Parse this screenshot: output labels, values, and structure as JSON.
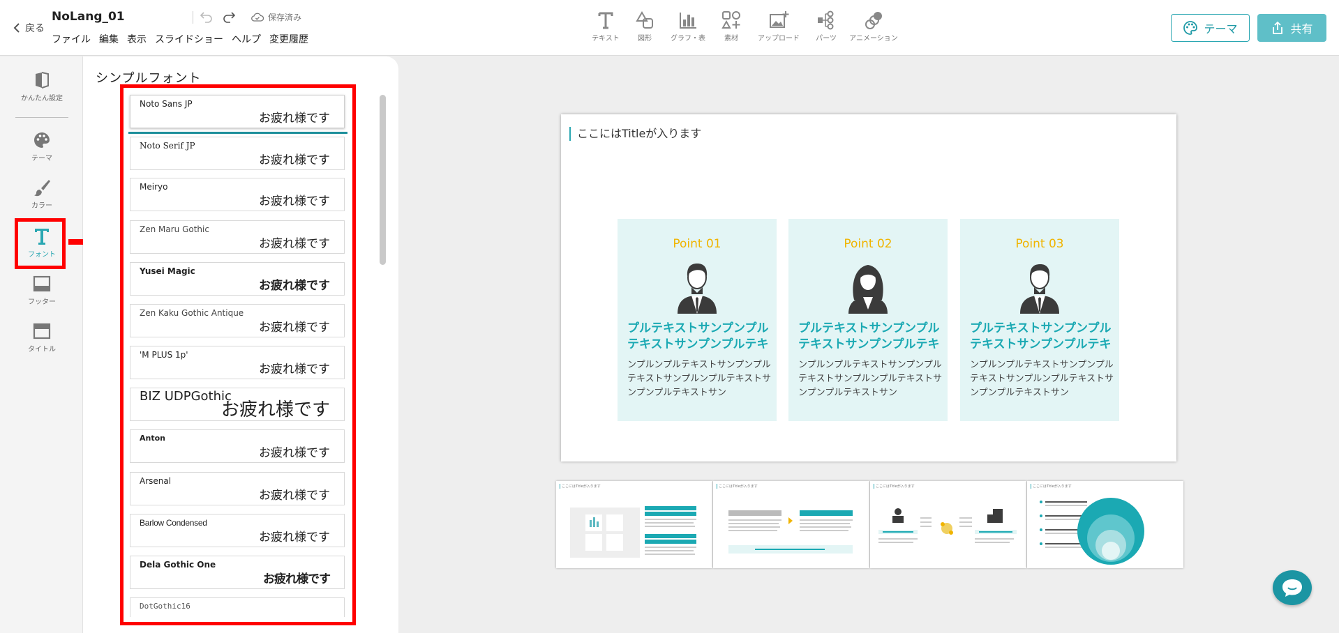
{
  "header": {
    "back_label": "戻る",
    "doc_title": "NoLang_01",
    "menus": [
      "ファイル",
      "編集",
      "表示",
      "スライドショー",
      "ヘルプ",
      "変更履歴"
    ],
    "save_status": "保存済み"
  },
  "tools": [
    {
      "label": "テキスト",
      "icon": "text-icon"
    },
    {
      "label": "図形",
      "icon": "shapes-icon"
    },
    {
      "label": "グラフ・表",
      "icon": "chart-icon"
    },
    {
      "label": "素材",
      "icon": "materials-icon"
    },
    {
      "label": "アップロード",
      "icon": "upload-image-icon"
    },
    {
      "label": "パーツ",
      "icon": "parts-icon"
    },
    {
      "label": "アニメーション",
      "icon": "animation-icon"
    }
  ],
  "actions": {
    "theme_label": "テーマ",
    "share_label": "共有",
    "accent_color": "#2aa7b2"
  },
  "rail": [
    {
      "label": "かんたん設定",
      "icon": "easy-setup-icon"
    },
    {
      "label": "テーマ",
      "icon": "palette-icon"
    },
    {
      "label": "カラー",
      "icon": "brush-icon"
    },
    {
      "label": "フォント",
      "icon": "font-icon",
      "active": true
    },
    {
      "label": "フッター",
      "icon": "footer-icon"
    },
    {
      "label": "タイトル",
      "icon": "title-icon"
    }
  ],
  "font_panel": {
    "title": "シンプルフォント",
    "sample_text": "お疲れ様です",
    "fonts": [
      {
        "name": "Noto Sans JP",
        "selected": true
      },
      {
        "name": "Noto Serif JP"
      },
      {
        "name": "Meiryo"
      },
      {
        "name": "Zen Maru Gothic"
      },
      {
        "name": "Yusei Magic"
      },
      {
        "name": "Zen Kaku Gothic Antique"
      },
      {
        "name": "'M PLUS 1p'"
      },
      {
        "name": "BIZ UDPGothic"
      },
      {
        "name": "Anton"
      },
      {
        "name": "Arsenal"
      },
      {
        "name": "Barlow Condensed"
      },
      {
        "name": "Dela Gothic One"
      },
      {
        "name": "DotGothic16"
      }
    ]
  },
  "slide": {
    "title": "ここにはTitleが入ります",
    "points": [
      {
        "label": "Point 01",
        "figure": "man",
        "heading": "プルテキストサンプンプルテキストサンプンプルテキ",
        "body": "ンプルンプルテキストサンプンプルテキストサンプルンプルテキストサンプンプルテキストサン"
      },
      {
        "label": "Point 02",
        "figure": "woman",
        "heading": "プルテキストサンプンプルテキストサンプンプルテキ",
        "body": "ンプルンプルテキストサンプンプルテキストサンプルンプルテキストサンプンプルテキストサン"
      },
      {
        "label": "Point 03",
        "figure": "man",
        "heading": "プルテキストサンプンプルテキストサンプンプルテキ",
        "body": "ンプルンプルテキストサンプンプルテキストサンプルンプルテキストサンプンプルテキストサン"
      }
    ],
    "card_color": "#e3f5f5",
    "point_label_color": "#f0b400",
    "heading_color": "#1ba9b3"
  },
  "thumbnails": [
    {
      "title": "ここにはTitleが入ります"
    },
    {
      "title": "ここにはTitleが入ります"
    },
    {
      "title": "ここにはTitleが入ります"
    },
    {
      "title": "ここにはTitleが入ります"
    }
  ]
}
